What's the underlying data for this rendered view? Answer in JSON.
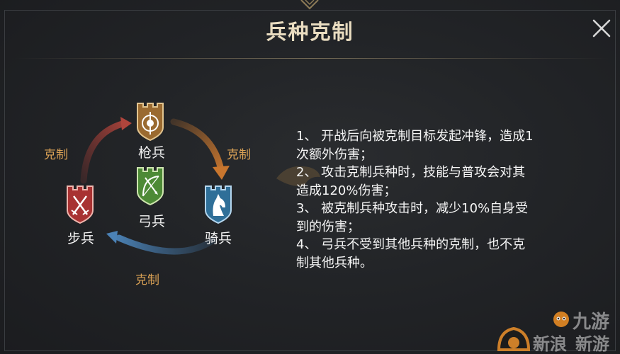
{
  "dialog": {
    "title": "兵种克制",
    "close_icon": "close-icon"
  },
  "units": {
    "spear": {
      "label": "枪兵",
      "icon": "spear-shield-icon",
      "color": "#a06a2c"
    },
    "archer": {
      "label": "弓兵",
      "icon": "bow-shield-icon",
      "color": "#4f8a3a"
    },
    "infantry": {
      "label": "步兵",
      "icon": "crossed-swords-shield-icon",
      "color": "#a83232"
    },
    "cavalry": {
      "label": "骑兵",
      "icon": "horse-shield-icon",
      "color": "#2f6f98"
    }
  },
  "counters": {
    "left": "克制",
    "right": "克制",
    "bottom": "克制"
  },
  "rules": [
    "1、   开战后向被克制目标发起冲锋，造成1",
    "次额外伤害；",
    "2、   攻击克制兵种时，技能与普攻会对其",
    "造成120%伤害；",
    "3、   被克制兵种攻击时，减少10%自身受",
    "到的伤害；",
    "4、   弓兵不受到其他兵种的克制，也不克",
    "制其他兵种。"
  ],
  "watermark": {
    "text_line1": "新浪",
    "text_line2": "九游",
    "text_line3": "新游"
  },
  "colors": {
    "title": "#e9dcc0",
    "counter_text": "#d9a155",
    "arrow_orange": "#c8762e",
    "arrow_red": "#9a3a34",
    "arrow_blue": "#3f6f9c"
  }
}
